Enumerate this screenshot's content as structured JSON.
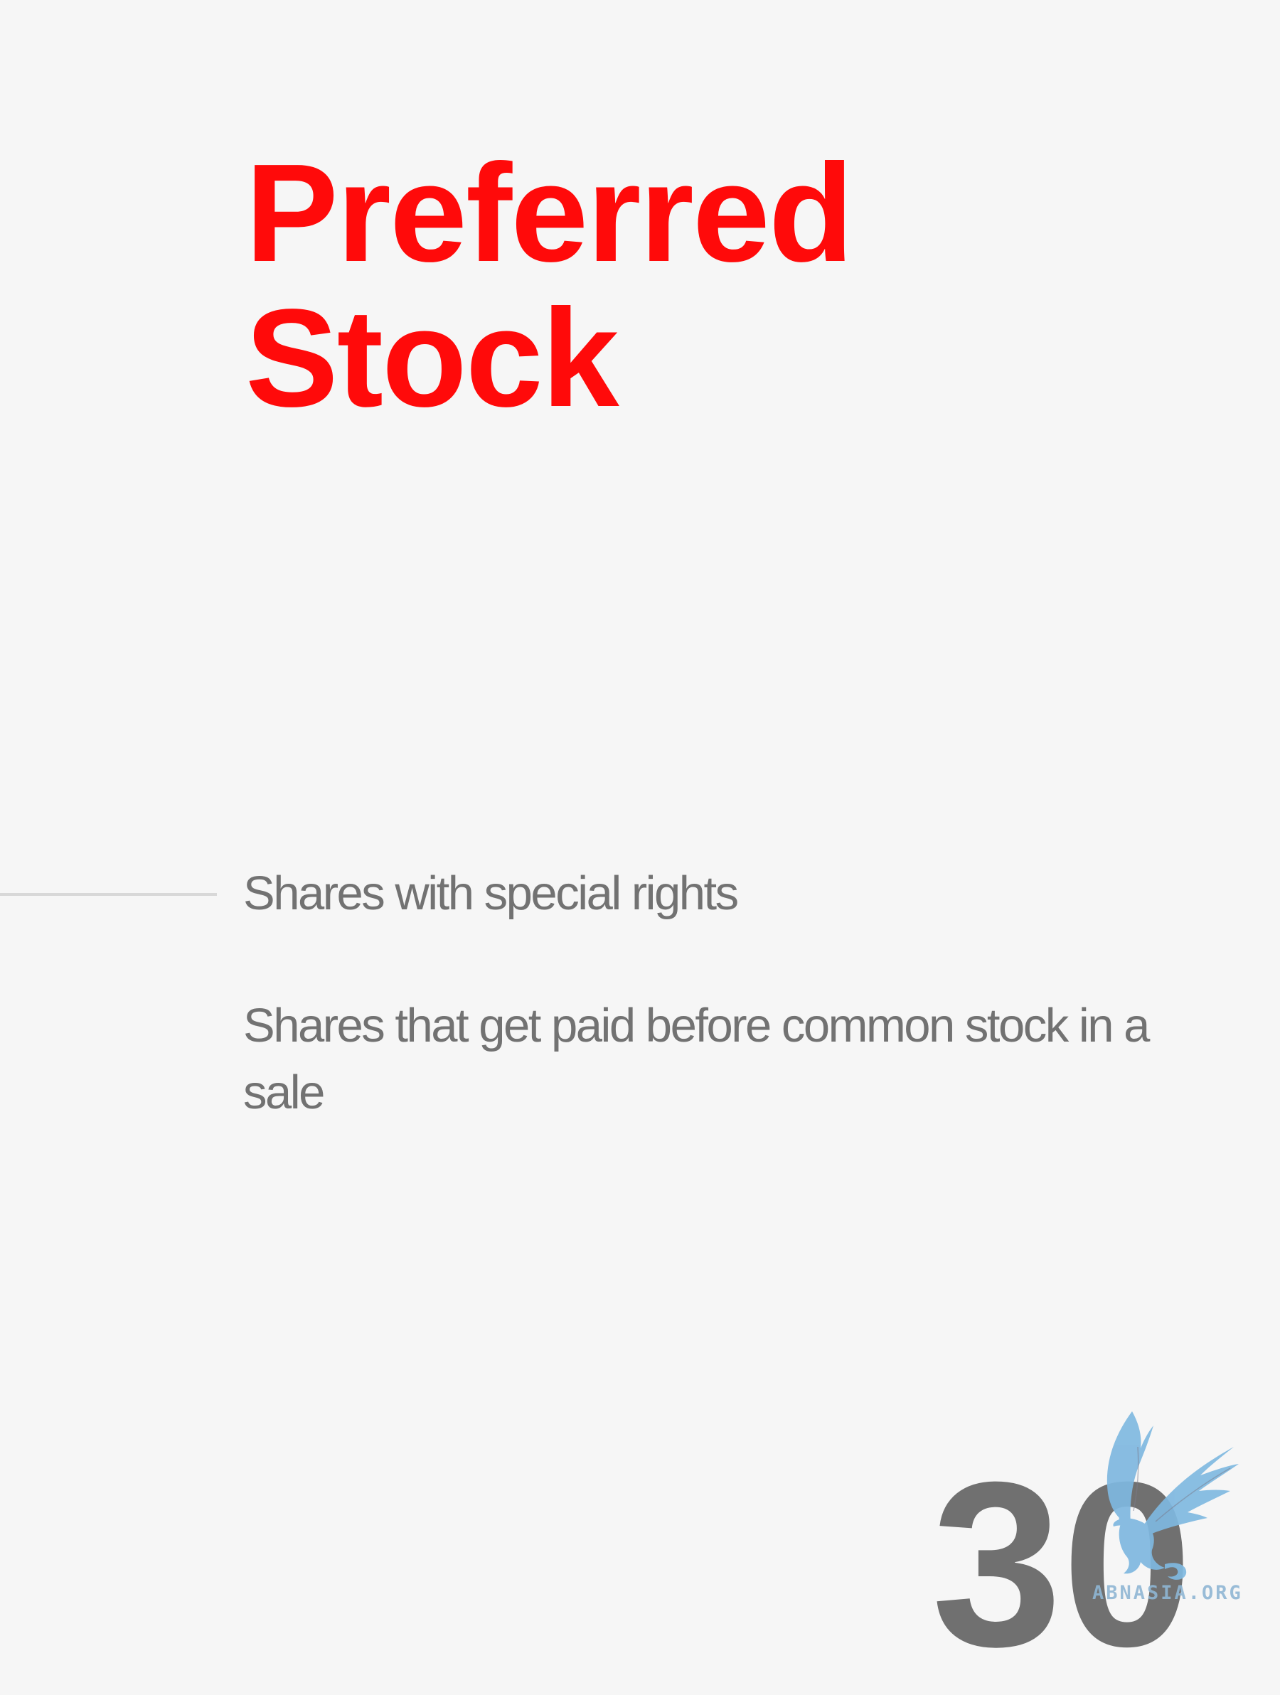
{
  "slide": {
    "title_line1": "Preferred",
    "title_line2": "Stock",
    "definitions": [
      "Shares with special rights",
      "Shares that get paid before common stock in a sale"
    ],
    "page_number": "30"
  },
  "watermark": {
    "text": "ABNASIA.ORG",
    "icon": "griffin-logo-icon"
  },
  "colors": {
    "background": "#f6f6f6",
    "title": "#ff0a0a",
    "body_text": "#727272",
    "page_number": "#707070",
    "logo": "#7fb8e0"
  }
}
